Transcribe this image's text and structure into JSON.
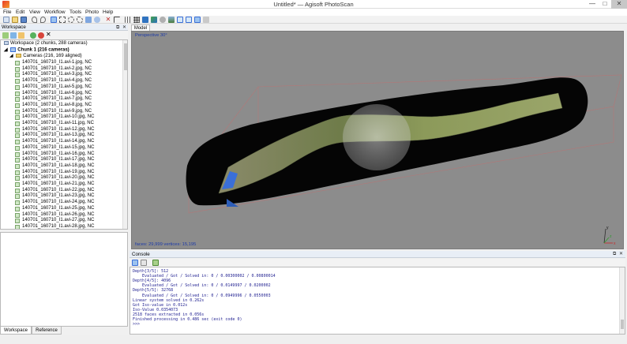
{
  "window": {
    "title": "Untitled* — Agisoft PhotoScan",
    "minimize_glyph": "—",
    "maximize_glyph": "□",
    "close_glyph": "✕"
  },
  "menu": [
    "File",
    "Edit",
    "View",
    "Workflow",
    "Tools",
    "Photo",
    "Help"
  ],
  "toolbar_icons": [
    "new-icon",
    "open-icon",
    "save-icon",
    "undo-icon",
    "redo-icon",
    "select-icon",
    "rect-select-icon",
    "circle-select-icon",
    "free-select-icon",
    "move-icon",
    "rotate-icon",
    "delete-icon",
    "crop-icon",
    "grid-icon",
    "points-icon",
    "dense-points-icon",
    "mesh-icon",
    "shaded-icon",
    "textured-icon",
    "cameras-icon",
    "orthographic-icon",
    "reset-view-icon",
    "navigate-icon"
  ],
  "workspace": {
    "panel_title": "Workspace",
    "root_label": "Workspace (2 chunks, 288 cameras)",
    "chunk_label": "Chunk 1 (216 cameras)",
    "cameras_label": "Cameras (216, 169 aligned)",
    "cameras": [
      "140701_160710_I1.avi-1.jpg, NC",
      "140701_160710_I1.avi-2.jpg, NC",
      "140701_160710_I1.avi-3.jpg, NC",
      "140701_160710_I1.avi-4.jpg, NC",
      "140701_160710_I1.avi-5.jpg, NC",
      "140701_160710_I1.avi-6.jpg, NC",
      "140701_160710_I1.avi-7.jpg, NC",
      "140701_160710_I1.avi-8.jpg, NC",
      "140701_160710_I1.avi-9.jpg, NC",
      "140701_160710_I1.avi-10.jpg, NC",
      "140701_160710_I1.avi-11.jpg, NC",
      "140701_160710_I1.avi-12.jpg, NC",
      "140701_160710_I1.avi-13.jpg, NC",
      "140701_160710_I1.avi-14.jpg, NC",
      "140701_160710_I1.avi-15.jpg, NC",
      "140701_160710_I1.avi-16.jpg, NC",
      "140701_160710_I1.avi-17.jpg, NC",
      "140701_160710_I1.avi-18.jpg, NC",
      "140701_160710_I1.avi-19.jpg, NC",
      "140701_160710_I1.avi-20.jpg, NC",
      "140701_160710_I1.avi-21.jpg, NC",
      "140701_160710_I1.avi-22.jpg, NC",
      "140701_160710_I1.avi-23.jpg, NC",
      "140701_160710_I1.avi-24.jpg, NC",
      "140701_160710_I1.avi-25.jpg, NC",
      "140701_160710_I1.avi-26.jpg, NC",
      "140701_160710_I1.avi-27.jpg, NC",
      "140701_160710_I1.avi-28.jpg, NC"
    ]
  },
  "tabs": {
    "workspace": "Workspace",
    "reference": "Reference"
  },
  "model": {
    "tab_label": "Model",
    "projection": "Perspective 30°",
    "stats": "faces: 29,999 vertices: 15,195",
    "axis_x": "x",
    "axis_y": "y",
    "axis_z": "z"
  },
  "console": {
    "title": "Console",
    "lines": [
      "Depth[3/5]: 512",
      "    Evaluated / Got / Solved in: 0 / 0.00300002 / 0.00800014",
      "Depth[4/5]: 4096",
      "    Evaluated / Got / Solved in: 0 / 0.0149997 / 0.0200002",
      "Depth[5/5]: 32768",
      "    Evaluated / Got / Solved in: 0 / 0.0949996 / 0.0550003",
      "Linear system solved in 0.262s",
      "Got Iso-value in 0.012s",
      "Iso-Value 0.0354073",
      "2518 faces extracted in 0.056s",
      "Finished processing in 0.486 sec (exit code 0)",
      ">>>"
    ]
  },
  "colors": {
    "accent": "#3a6fd8",
    "console_text": "#1d1d8f",
    "viewport_bg": "#8c8c8c",
    "mesh_black": "#050505",
    "title_bar_blue": "#e8eef6"
  }
}
